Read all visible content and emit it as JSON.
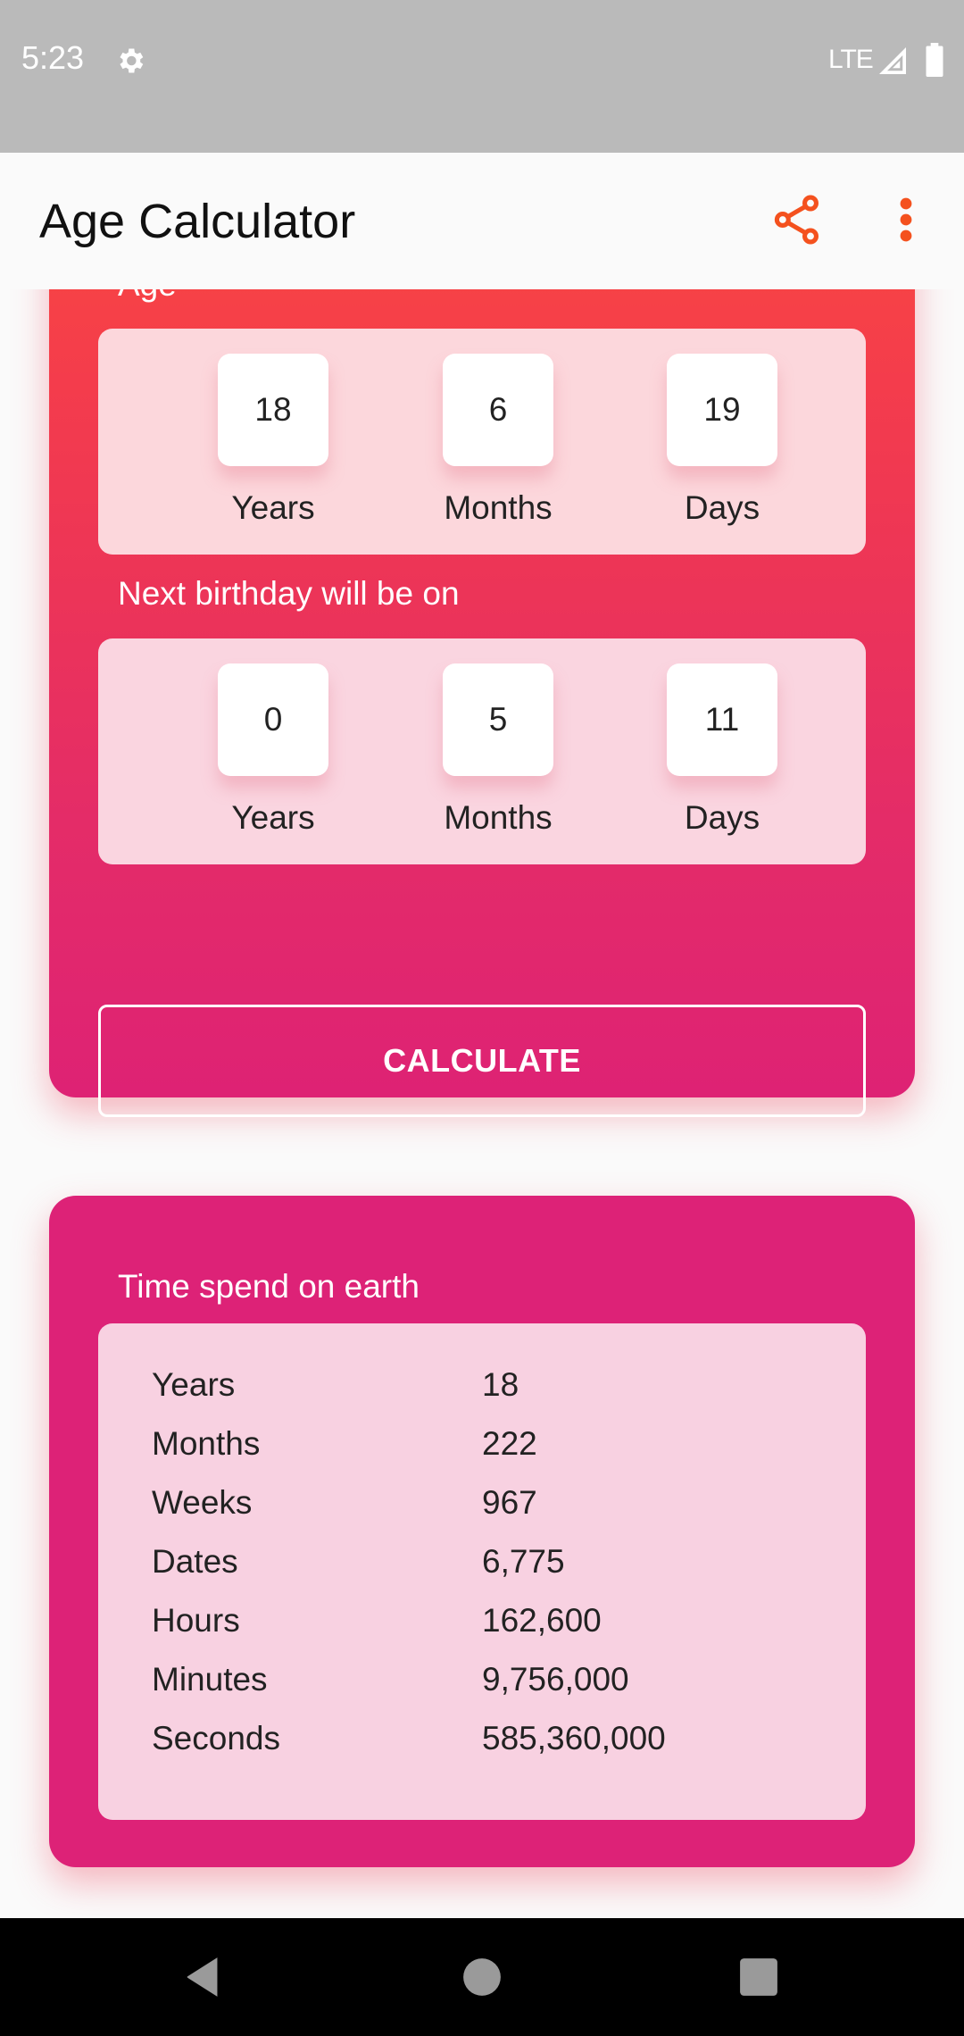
{
  "status_bar": {
    "time": "5:23",
    "network": "LTE",
    "icons": [
      "gear-icon",
      "signal-icon",
      "battery-icon"
    ]
  },
  "app_bar": {
    "title": "Age Calculator",
    "actions": [
      "share-icon",
      "more-vert-icon"
    ],
    "accent_color": "#f4511e"
  },
  "age_section": {
    "label": "Age",
    "items": [
      {
        "value": "18",
        "unit": "Years"
      },
      {
        "value": "6",
        "unit": "Months"
      },
      {
        "value": "19",
        "unit": "Days"
      }
    ]
  },
  "next_birthday_section": {
    "label": "Next birthday will be on",
    "items": [
      {
        "value": "0",
        "unit": "Years"
      },
      {
        "value": "5",
        "unit": "Months"
      },
      {
        "value": "11",
        "unit": "Days"
      }
    ]
  },
  "calculate_button": {
    "label": "CALCULATE"
  },
  "time_on_earth": {
    "label": "Time spend on earth",
    "rows": [
      {
        "key": "Years",
        "value": "18"
      },
      {
        "key": "Months",
        "value": "222"
      },
      {
        "key": "Weeks",
        "value": "967"
      },
      {
        "key": "Dates",
        "value": "6,775"
      },
      {
        "key": "Hours",
        "value": "162,600"
      },
      {
        "key": "Minutes",
        "value": "9,756,000"
      },
      {
        "key": "Seconds",
        "value": "585,360,000"
      }
    ]
  },
  "colors": {
    "gradient_top": "#f94840",
    "gradient_bottom": "#de2274",
    "card_pink": "#dd2277",
    "panel_light": "#f8d1e1"
  },
  "nav_bar": {
    "buttons": [
      "back-icon",
      "home-icon",
      "recents-icon"
    ]
  }
}
